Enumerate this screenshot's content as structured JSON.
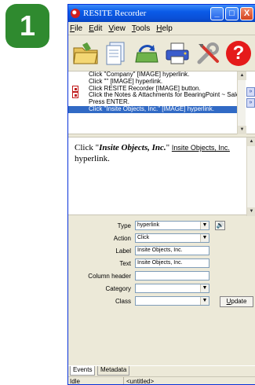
{
  "step_number": "1",
  "window": {
    "title": "RESITE Recorder",
    "buttons": {
      "minimize": "_",
      "maximize": "□",
      "close": "X"
    }
  },
  "menu": [
    {
      "first": "F",
      "rest": "ile"
    },
    {
      "first": "E",
      "rest": "dit"
    },
    {
      "first": "V",
      "rest": "iew"
    },
    {
      "first": "T",
      "rest": "ools"
    },
    {
      "first": "H",
      "rest": "elp"
    }
  ],
  "toolbar": {
    "icons": [
      "folder-icon",
      "document-icon",
      "refresh-icon",
      "printer-icon",
      "tools-icon",
      "help-icon"
    ],
    "help_glyph": "?"
  },
  "steps": [
    {
      "text": "Click \"Company\" [IMAGE] hyperlink.",
      "selected": false,
      "marker": false
    },
    {
      "text": "Click \"\" [IMAGE] hyperlink.",
      "selected": false,
      "marker": false
    },
    {
      "text": "Click RESITE Recorder [IMAGE] button.",
      "selected": false,
      "marker": true
    },
    {
      "text": "Click the Notes & Attachments for BearingPoint ~ Salesforce",
      "selected": false,
      "marker": true
    },
    {
      "text": "Press ENTER.",
      "selected": false,
      "marker": false
    },
    {
      "text": "Click \"Insite Objects, Inc.\" [IMAGE] hyperlink.",
      "selected": true,
      "marker": false
    }
  ],
  "preview": {
    "prefix": "Click \"",
    "bold": "Insite Objects, Inc.",
    "suffix": "\"",
    "link": "Insite Objects, Inc.",
    "tail": "hyperlink."
  },
  "properties": {
    "type": {
      "label": "Type",
      "value": "hyperlink"
    },
    "action": {
      "label": "Action",
      "value": "Click"
    },
    "label": {
      "label": "Label",
      "value": "Insite Objects, Inc."
    },
    "text": {
      "label": "Text",
      "value": "Insite Objects, Inc."
    },
    "column_header": {
      "label": "Column header",
      "value": ""
    },
    "category": {
      "label": "Category",
      "value": ""
    },
    "class": {
      "label": "Class",
      "value": ""
    }
  },
  "update_button": {
    "first": "U",
    "rest": "pdate"
  },
  "tabs": [
    "Events",
    "Metadata"
  ],
  "status": {
    "left": "Idle",
    "right": "<untitled>"
  }
}
